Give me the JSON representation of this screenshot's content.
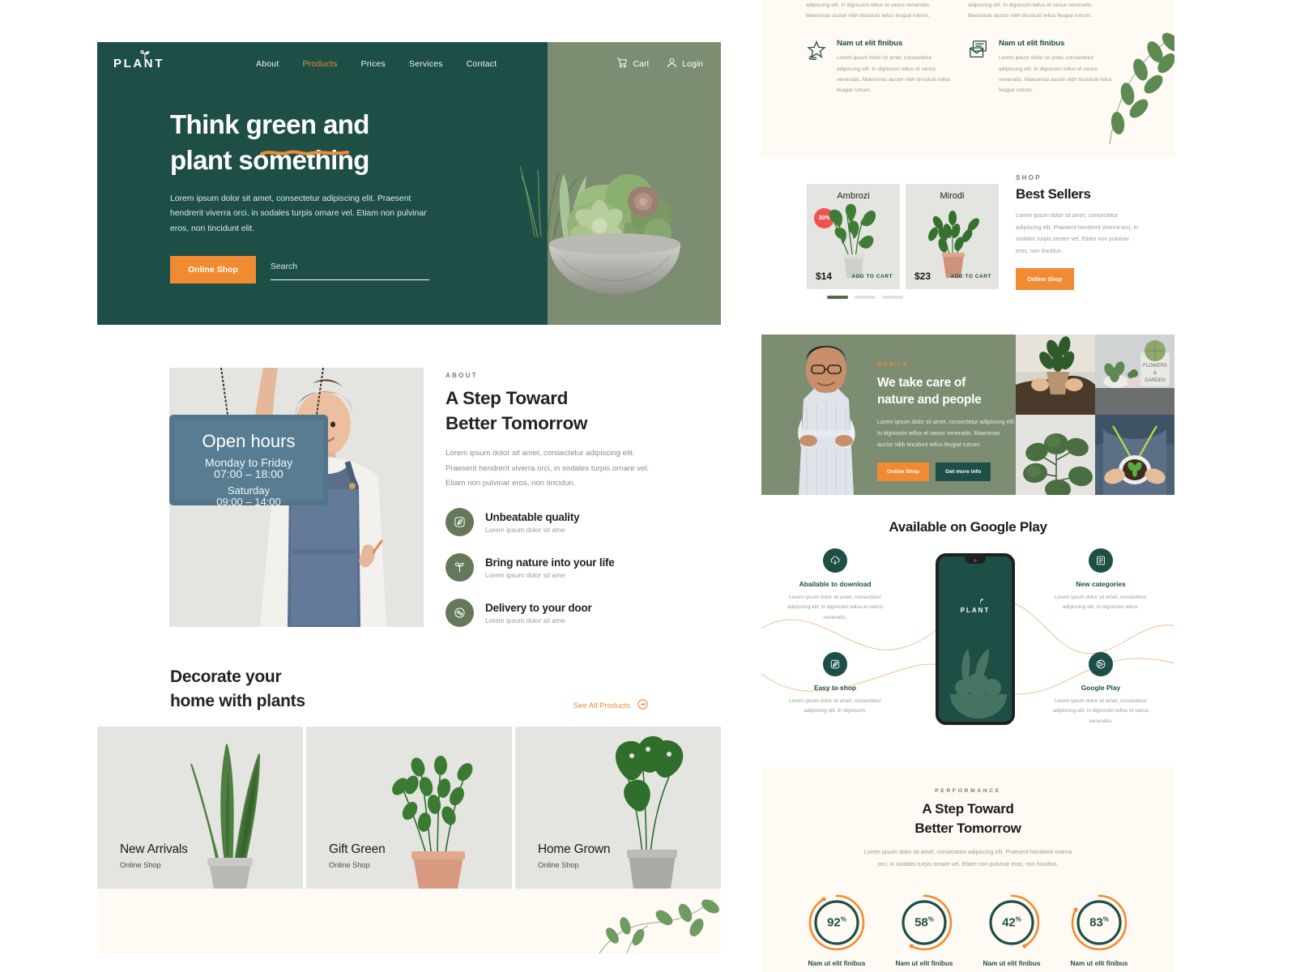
{
  "brand": {
    "name": "PLANT",
    "logo_icon": "sprout-icon"
  },
  "colors": {
    "dark_green": "#1d4f47",
    "sage": "#7d8d72",
    "orange": "#f18b32",
    "cream": "#fffaf4",
    "light_gray": "#e4e5e1",
    "red_badge": "#ef5350"
  },
  "nav": {
    "links": [
      {
        "label": "About",
        "active": false
      },
      {
        "label": "Products",
        "active": true
      },
      {
        "label": "Prices",
        "active": false
      },
      {
        "label": "Services",
        "active": false
      },
      {
        "label": "Contact",
        "active": false
      }
    ],
    "cart_label": "Cart",
    "cart_icon": "shopping-cart-icon",
    "login_label": "Login",
    "login_icon": "user-icon"
  },
  "hero": {
    "title_line1": "Think green and",
    "title_line2": "plant something",
    "paragraph": "Lorem ipsum dolor sit amet, consectetur adipiscing elit. Praesent hendrerit viverra orci, in sodales turpis ornare vel. Etiam non pulvinar eros, non tincidunt elit.",
    "cta_label": "Online Shop",
    "search_placeholder": "Search",
    "search_value": "",
    "carousel": {
      "total": 3,
      "active_index": 0
    }
  },
  "sign": {
    "title": "Open hours",
    "line1": "Monday to Friday",
    "line2": "07:00 – 18:00",
    "line3": "Saturday",
    "line4": "09:00 – 14:00"
  },
  "about": {
    "eyebrow": "ABOUT",
    "title_line1": "A Step Toward",
    "title_line2": "Better Tomorrow",
    "paragraph": "Lorem ipsum dolor sit amet, consectetur adipiscing elit. Praesent hendrerit viverra orci, in sodales turpis ornare vel. Etiam non pulvinar eros, non tincidun.",
    "features": [
      {
        "icon": "leaf-badge-icon",
        "title": "Unbeatable quality",
        "subtitle": "Lorem ipsum dolor sit ame"
      },
      {
        "icon": "sprout-icon",
        "title": "Bring nature into your life",
        "subtitle": "Lorem ipsum dolor sit ame"
      },
      {
        "icon": "delivery-icon",
        "title": "Delivery to your door",
        "subtitle": "Lorem ipsum dolor sit ame"
      }
    ]
  },
  "decorate": {
    "title_line1": "Decorate your",
    "title_line2": "home with plants",
    "see_all_label": "See All Products",
    "see_all_icon": "arrow-right-circle-icon",
    "cards": [
      {
        "title": "New Arrivals",
        "subtitle": "Online Shop"
      },
      {
        "title": "Gift Green",
        "subtitle": "Online Shop"
      },
      {
        "title": "Home Grown",
        "subtitle": "Online Shop"
      }
    ]
  },
  "right_features": {
    "top_text": "adipiscing elit. In dignissim tellus et varius venenatis. Maecenas auctor nibh tincidunt tellus feugiat rutrum.",
    "items": [
      {
        "icon": "star-waves-icon",
        "title": "Nam ut elit finibus",
        "text": "Lorem ipsum dolor sit amet, consectetur adipiscing elit. In dignissim tellus et varius venenatis. Maecenas auctor nibh tincidunt tellus feugiat rutrum."
      },
      {
        "icon": "envelope-icon",
        "title": "Nam ut elit finibus",
        "text": "Lorem ipsum dolor sit amet, consectetur adipiscing elit. In dignissim tellus et varius venenatis. Maecenas auctor nibh tincidunt tellus feugiat rutrum."
      }
    ]
  },
  "best_sellers": {
    "eyebrow": "SHOP",
    "title": "Best Sellers",
    "paragraph": "Lorem ipsum dolor sit amet, consectetur adipiscing elit. Praesent hendrerit viverra orci, in sodales turpis ornare vel. Etiam non pulvinar eros, non tincidun.",
    "cta_label": "Online Shop",
    "products": [
      {
        "name": "Ambrozi",
        "price": "$14",
        "badge": "30%",
        "add_label": "ADD TO CART"
      },
      {
        "name": "Mirodi",
        "price": "$23",
        "badge": null,
        "add_label": "ADD TO CART"
      }
    ],
    "carousel": {
      "total": 3,
      "active_index": 0
    }
  },
  "care": {
    "eyebrow": "MOBILE",
    "title_line1": "We take care of",
    "title_line2": "nature and people",
    "paragraph": "Lorem ipsum dolor sit amet, consectetur adipiscing elit. In dignissim tellus et varius venenatis. Maecenas auctor nibh tincidunt tellus feugiat rutrum.",
    "primary_cta": "Online Shop",
    "secondary_cta": "Get more info",
    "gallery": [
      "repotting-plant-photo",
      "flowers-garden-pots-photo",
      "rubber-plant-photo",
      "hands-holding-seedling-photo"
    ]
  },
  "google_play": {
    "title": "Available on Google Play",
    "phone_logo": "PLANT",
    "items": [
      {
        "icon": "cloud-download-icon",
        "title": "Abailable to download",
        "text": "Lorem ipsum dolor sit amet, consectetur adipiscing elit. In dignissim tellus et varius venenatis."
      },
      {
        "icon": "list-icon",
        "title": "New categories",
        "text": "Lorem ipsum dolor sit amet, consectetur adipiscing elit. In dignissim tellus."
      },
      {
        "icon": "leaf-badge-icon",
        "title": "Easy to shop",
        "text": "Lorem ipsum dolor sit amet, consectetur adipiscing elit. In dignissim."
      },
      {
        "icon": "google-play-icon",
        "title": "Google Play",
        "text": "Lorem ipsum dolor sit amet, consectetur adipiscing elit. In dignissim tellus et varius venenatis."
      }
    ]
  },
  "performance": {
    "eyebrow": "PERFORMANCE",
    "title_line1": "A Step Toward",
    "title_line2": "Better Tomorrow",
    "paragraph": "Lorem ipsum dolor sit amet, consectetur adipiscing elit. Praesent hendrerit viverra orci, in sodales turpis ornare vel. Etiam non pulvinar eros, non tincidun."
  },
  "chart_data": {
    "type": "bar",
    "title": "A Step Toward Better Tomorrow",
    "subtitle": "PERFORMANCE",
    "categories": [
      "Nam ut elit finibus",
      "Nam ut elit finibus",
      "Nam ut elit finibus",
      "Nam ut elit finibus"
    ],
    "values": [
      92,
      58,
      42,
      83
    ],
    "value_labels": [
      "92%",
      "58%",
      "42%",
      "83%"
    ],
    "unit": "%",
    "ylim": [
      0,
      100
    ],
    "xlabel": "",
    "ylabel": "",
    "grid": false,
    "legend": "none",
    "series": [
      {
        "name": "Performance",
        "values": [
          92,
          58,
          42,
          83
        ]
      }
    ],
    "style": "radial-progress-rings",
    "ring_track_color": "#1d4f47",
    "ring_progress_color": "#f18b32"
  }
}
